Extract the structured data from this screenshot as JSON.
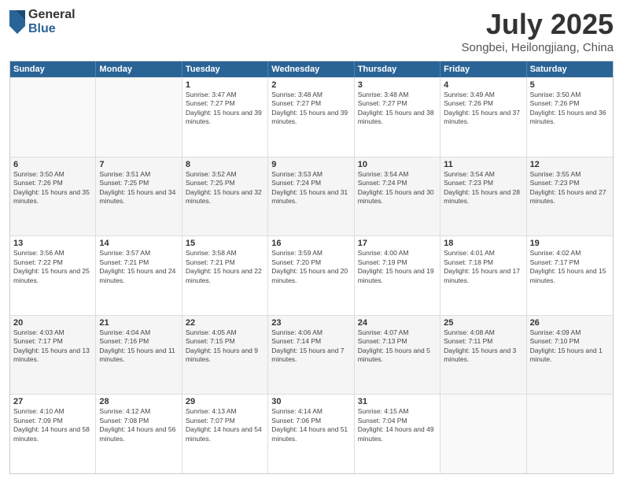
{
  "logo": {
    "general": "General",
    "blue": "Blue"
  },
  "title": "July 2025",
  "subtitle": "Songbei, Heilongjiang, China",
  "days_of_week": [
    "Sunday",
    "Monday",
    "Tuesday",
    "Wednesday",
    "Thursday",
    "Friday",
    "Saturday"
  ],
  "weeks": [
    [
      {
        "day": "",
        "sunrise": "",
        "sunset": "",
        "daylight": ""
      },
      {
        "day": "",
        "sunrise": "",
        "sunset": "",
        "daylight": ""
      },
      {
        "day": "1",
        "sunrise": "Sunrise: 3:47 AM",
        "sunset": "Sunset: 7:27 PM",
        "daylight": "Daylight: 15 hours and 39 minutes."
      },
      {
        "day": "2",
        "sunrise": "Sunrise: 3:48 AM",
        "sunset": "Sunset: 7:27 PM",
        "daylight": "Daylight: 15 hours and 39 minutes."
      },
      {
        "day": "3",
        "sunrise": "Sunrise: 3:48 AM",
        "sunset": "Sunset: 7:27 PM",
        "daylight": "Daylight: 15 hours and 38 minutes."
      },
      {
        "day": "4",
        "sunrise": "Sunrise: 3:49 AM",
        "sunset": "Sunset: 7:26 PM",
        "daylight": "Daylight: 15 hours and 37 minutes."
      },
      {
        "day": "5",
        "sunrise": "Sunrise: 3:50 AM",
        "sunset": "Sunset: 7:26 PM",
        "daylight": "Daylight: 15 hours and 36 minutes."
      }
    ],
    [
      {
        "day": "6",
        "sunrise": "Sunrise: 3:50 AM",
        "sunset": "Sunset: 7:26 PM",
        "daylight": "Daylight: 15 hours and 35 minutes."
      },
      {
        "day": "7",
        "sunrise": "Sunrise: 3:51 AM",
        "sunset": "Sunset: 7:25 PM",
        "daylight": "Daylight: 15 hours and 34 minutes."
      },
      {
        "day": "8",
        "sunrise": "Sunrise: 3:52 AM",
        "sunset": "Sunset: 7:25 PM",
        "daylight": "Daylight: 15 hours and 32 minutes."
      },
      {
        "day": "9",
        "sunrise": "Sunrise: 3:53 AM",
        "sunset": "Sunset: 7:24 PM",
        "daylight": "Daylight: 15 hours and 31 minutes."
      },
      {
        "day": "10",
        "sunrise": "Sunrise: 3:54 AM",
        "sunset": "Sunset: 7:24 PM",
        "daylight": "Daylight: 15 hours and 30 minutes."
      },
      {
        "day": "11",
        "sunrise": "Sunrise: 3:54 AM",
        "sunset": "Sunset: 7:23 PM",
        "daylight": "Daylight: 15 hours and 28 minutes."
      },
      {
        "day": "12",
        "sunrise": "Sunrise: 3:55 AM",
        "sunset": "Sunset: 7:23 PM",
        "daylight": "Daylight: 15 hours and 27 minutes."
      }
    ],
    [
      {
        "day": "13",
        "sunrise": "Sunrise: 3:56 AM",
        "sunset": "Sunset: 7:22 PM",
        "daylight": "Daylight: 15 hours and 25 minutes."
      },
      {
        "day": "14",
        "sunrise": "Sunrise: 3:57 AM",
        "sunset": "Sunset: 7:21 PM",
        "daylight": "Daylight: 15 hours and 24 minutes."
      },
      {
        "day": "15",
        "sunrise": "Sunrise: 3:58 AM",
        "sunset": "Sunset: 7:21 PM",
        "daylight": "Daylight: 15 hours and 22 minutes."
      },
      {
        "day": "16",
        "sunrise": "Sunrise: 3:59 AM",
        "sunset": "Sunset: 7:20 PM",
        "daylight": "Daylight: 15 hours and 20 minutes."
      },
      {
        "day": "17",
        "sunrise": "Sunrise: 4:00 AM",
        "sunset": "Sunset: 7:19 PM",
        "daylight": "Daylight: 15 hours and 19 minutes."
      },
      {
        "day": "18",
        "sunrise": "Sunrise: 4:01 AM",
        "sunset": "Sunset: 7:18 PM",
        "daylight": "Daylight: 15 hours and 17 minutes."
      },
      {
        "day": "19",
        "sunrise": "Sunrise: 4:02 AM",
        "sunset": "Sunset: 7:17 PM",
        "daylight": "Daylight: 15 hours and 15 minutes."
      }
    ],
    [
      {
        "day": "20",
        "sunrise": "Sunrise: 4:03 AM",
        "sunset": "Sunset: 7:17 PM",
        "daylight": "Daylight: 15 hours and 13 minutes."
      },
      {
        "day": "21",
        "sunrise": "Sunrise: 4:04 AM",
        "sunset": "Sunset: 7:16 PM",
        "daylight": "Daylight: 15 hours and 11 minutes."
      },
      {
        "day": "22",
        "sunrise": "Sunrise: 4:05 AM",
        "sunset": "Sunset: 7:15 PM",
        "daylight": "Daylight: 15 hours and 9 minutes."
      },
      {
        "day": "23",
        "sunrise": "Sunrise: 4:06 AM",
        "sunset": "Sunset: 7:14 PM",
        "daylight": "Daylight: 15 hours and 7 minutes."
      },
      {
        "day": "24",
        "sunrise": "Sunrise: 4:07 AM",
        "sunset": "Sunset: 7:13 PM",
        "daylight": "Daylight: 15 hours and 5 minutes."
      },
      {
        "day": "25",
        "sunrise": "Sunrise: 4:08 AM",
        "sunset": "Sunset: 7:11 PM",
        "daylight": "Daylight: 15 hours and 3 minutes."
      },
      {
        "day": "26",
        "sunrise": "Sunrise: 4:09 AM",
        "sunset": "Sunset: 7:10 PM",
        "daylight": "Daylight: 15 hours and 1 minute."
      }
    ],
    [
      {
        "day": "27",
        "sunrise": "Sunrise: 4:10 AM",
        "sunset": "Sunset: 7:09 PM",
        "daylight": "Daylight: 14 hours and 58 minutes."
      },
      {
        "day": "28",
        "sunrise": "Sunrise: 4:12 AM",
        "sunset": "Sunset: 7:08 PM",
        "daylight": "Daylight: 14 hours and 56 minutes."
      },
      {
        "day": "29",
        "sunrise": "Sunrise: 4:13 AM",
        "sunset": "Sunset: 7:07 PM",
        "daylight": "Daylight: 14 hours and 54 minutes."
      },
      {
        "day": "30",
        "sunrise": "Sunrise: 4:14 AM",
        "sunset": "Sunset: 7:06 PM",
        "daylight": "Daylight: 14 hours and 51 minutes."
      },
      {
        "day": "31",
        "sunrise": "Sunrise: 4:15 AM",
        "sunset": "Sunset: 7:04 PM",
        "daylight": "Daylight: 14 hours and 49 minutes."
      },
      {
        "day": "",
        "sunrise": "",
        "sunset": "",
        "daylight": ""
      },
      {
        "day": "",
        "sunrise": "",
        "sunset": "",
        "daylight": ""
      }
    ]
  ]
}
